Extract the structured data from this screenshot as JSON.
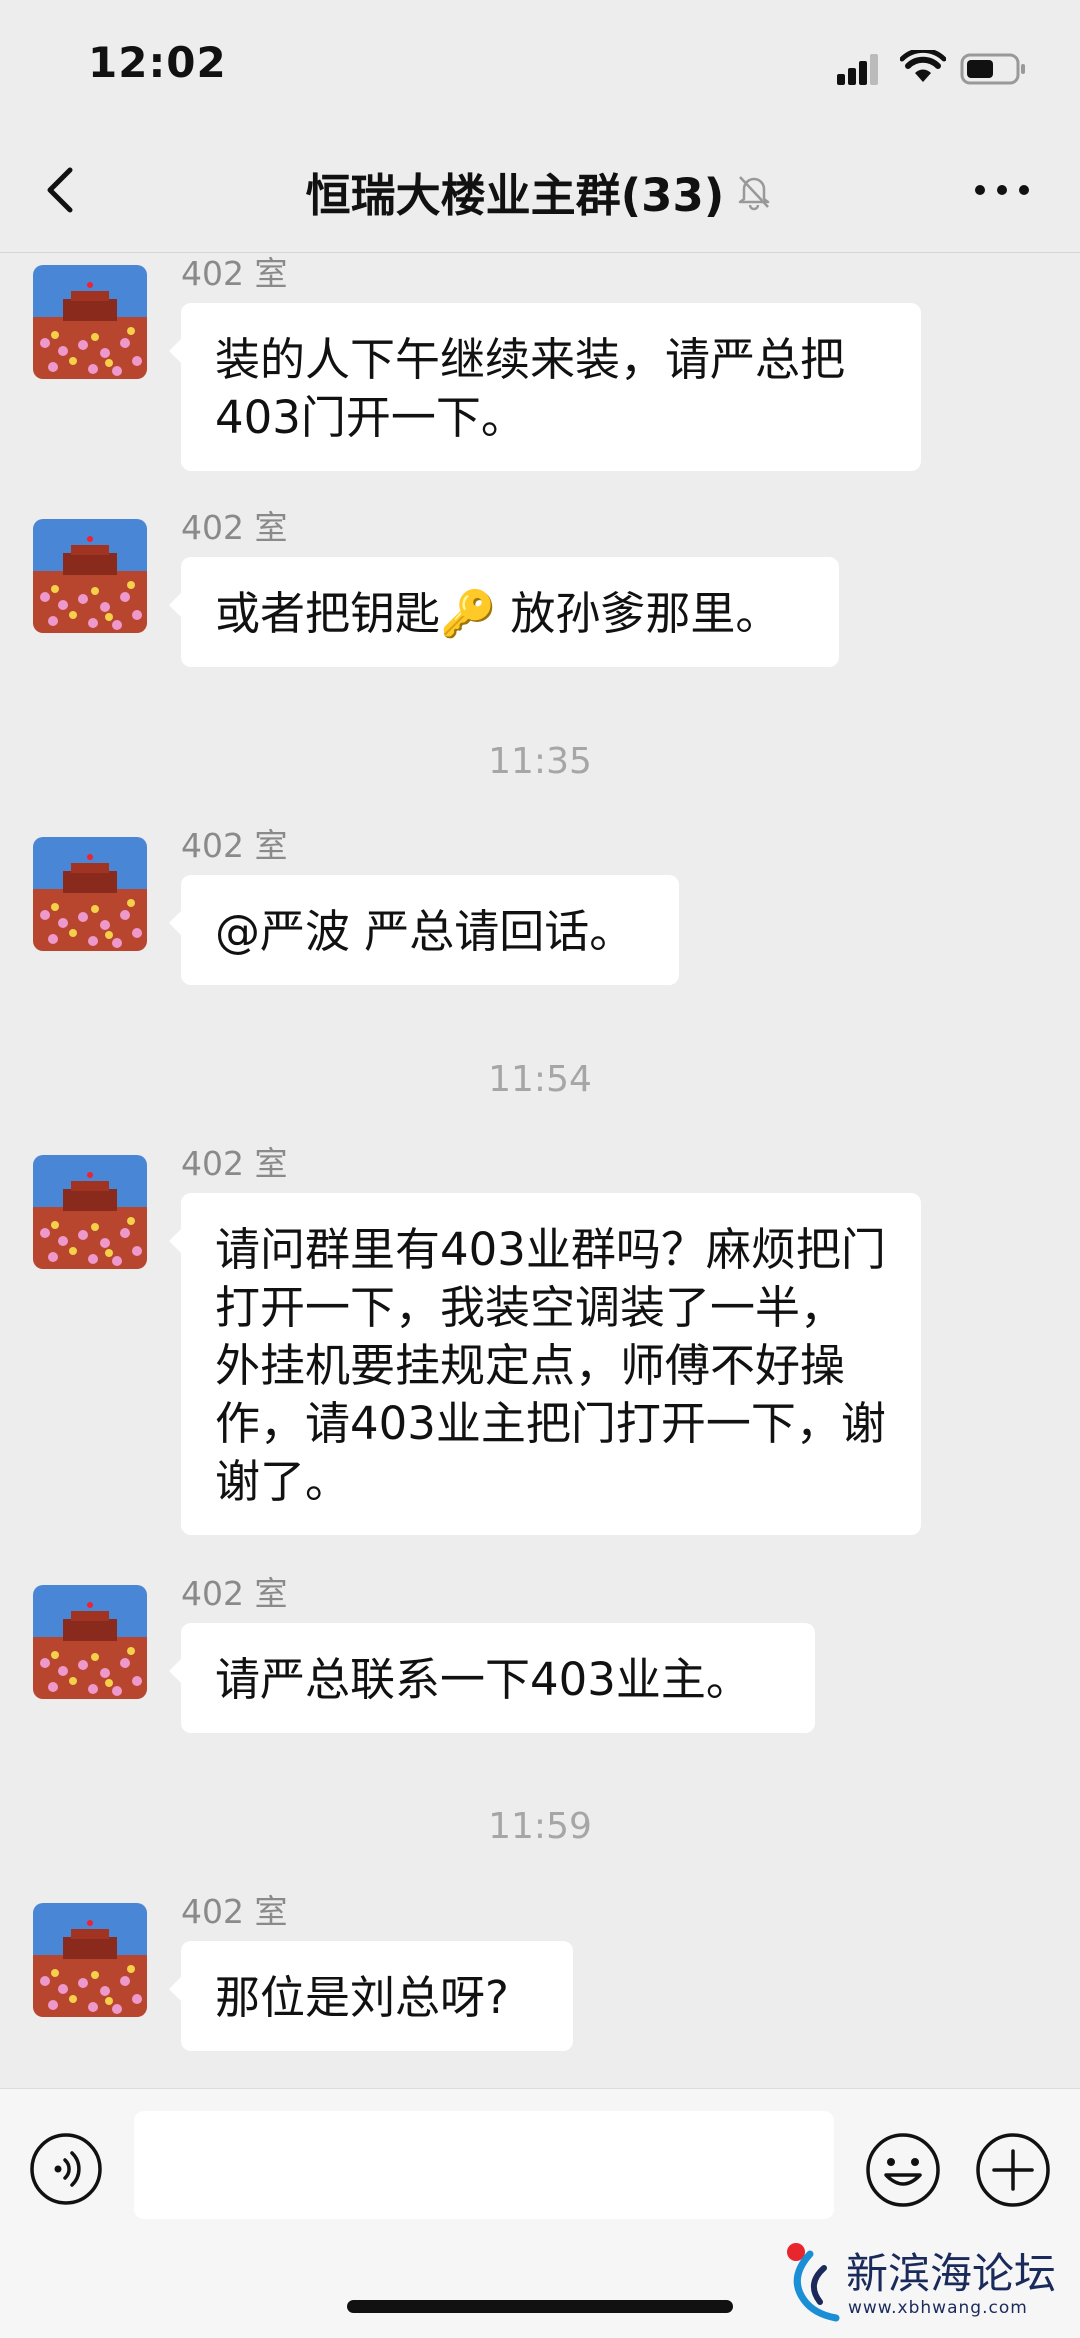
{
  "status_bar": {
    "time": "12:02"
  },
  "nav": {
    "title": "恒瑞大楼业主群(33)"
  },
  "messages": [
    {
      "sender": "402 室",
      "text": "装的人下午继续来装，请严总把403门开一下。"
    },
    {
      "sender": "402 室",
      "text": "或者把钥匙🔑 放孙爹那里。"
    },
    {
      "divider": "11:35"
    },
    {
      "sender": "402 室",
      "text": "@严波 严总请回话。"
    },
    {
      "divider": "11:54"
    },
    {
      "sender": "402 室",
      "text": "请问群里有403业群吗？麻烦把门打开一下，我装空调装了一半，外挂机要挂规定点，师傅不好操作，请403业主把门打开一下，谢谢了。"
    },
    {
      "sender": "402 室",
      "text": "请严总联系一下403业主。"
    },
    {
      "divider": "11:59"
    },
    {
      "sender": "402 室",
      "text": "那位是刘总呀?"
    }
  ],
  "watermark": {
    "name": "新滨海论坛",
    "url": "www.xbhwang.com"
  },
  "colors": {
    "background": "#ededed",
    "bubble": "#ffffff",
    "meta_text": "#8a8a8a"
  }
}
